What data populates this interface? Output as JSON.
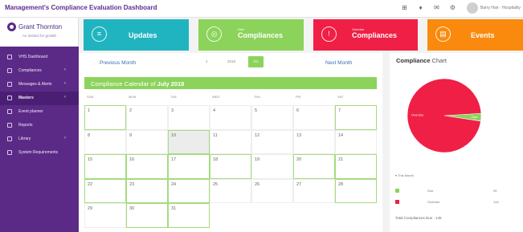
{
  "app": {
    "title": "Management's Compliance Evaluation Dashboard"
  },
  "user": {
    "name": "Barry Han · Hospitality"
  },
  "topbar_icons": [
    "grid-icon",
    "bell-icon",
    "mail-icon",
    "settings-icon"
  ],
  "logo": {
    "name": "Grant Thornton",
    "tagline": "An instinct for growth"
  },
  "sidebar": {
    "items": [
      {
        "label": "VHS Dashboard",
        "arrow": ""
      },
      {
        "label": "Compliances",
        "arrow": "‹"
      },
      {
        "label": "Messages & Alerts",
        "arrow": "‹"
      },
      {
        "label": "Masters",
        "arrow": "‹"
      },
      {
        "label": "Event planner",
        "arrow": ""
      },
      {
        "label": "Reports",
        "arrow": ""
      },
      {
        "label": "Library",
        "arrow": "‹"
      },
      {
        "label": "System Requirements",
        "arrow": ""
      }
    ]
  },
  "tiles": [
    {
      "sup": "",
      "label": "Updates",
      "icon": "≡",
      "color": "#20b4c0"
    },
    {
      "sup": "New",
      "label": "Compliances",
      "icon": "◎",
      "color": "#8cd35c"
    },
    {
      "sup": "Overdue",
      "label": "Compliances",
      "icon": "!",
      "color": "#f01f46"
    },
    {
      "sup": "",
      "label": "Events",
      "icon": "▤",
      "color": "#f98a0e"
    }
  ],
  "calendar": {
    "prev_label": "Previous Month",
    "next_label": "Next Month",
    "view_options": [
      "1",
      "2018"
    ],
    "view_active": "Go",
    "title_prefix": "Compliance Calendar of ",
    "title_month": "July 2018",
    "weekdays": [
      "SUN",
      "MON",
      "TUE",
      "WED",
      "THU",
      "FRI",
      "SAT"
    ],
    "weeks": [
      [
        "1",
        "2",
        "3",
        "4",
        "5",
        "6",
        "7"
      ],
      [
        "8",
        "9",
        "10",
        "11",
        "12",
        "13",
        "14"
      ],
      [
        "15",
        "16",
        "17",
        "18",
        "19",
        "20",
        "21"
      ],
      [
        "22",
        "23",
        "24",
        "25",
        "26",
        "27",
        "28"
      ],
      [
        "29",
        "30",
        "31",
        "",
        "",
        "",
        ""
      ]
    ],
    "highlighted_days": [
      "1",
      "7",
      "10",
      "15",
      "16",
      "17",
      "18",
      "20",
      "21",
      "22",
      "23",
      "24",
      "28",
      "30",
      "31"
    ],
    "today": "10"
  },
  "chart": {
    "title_bold": "Compliance",
    "title_rest": " Chart",
    "legend_head": "▾ This Month",
    "total_label": "Total Compliances Due :",
    "total_value": "149",
    "colors": {
      "due": "#8cd35c",
      "overdue": "#f01f46"
    }
  },
  "chart_data": {
    "type": "pie",
    "title": "Compliance Chart",
    "slices": [
      {
        "label": "Due",
        "value": 5,
        "color": "#8cd35c",
        "shown": "Due",
        "table_value": "05"
      },
      {
        "label": "Overdue",
        "value": 144,
        "color": "#f01f46",
        "shown": "Overdue",
        "table_value": "144"
      }
    ],
    "legend_placement": "bottom"
  }
}
